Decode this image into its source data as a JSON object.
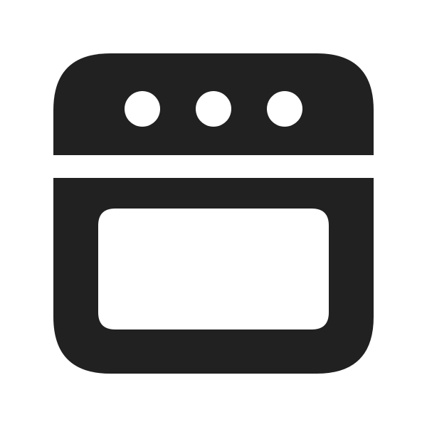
{
  "icon": {
    "name": "oven-icon",
    "color": "#212121",
    "background": "#ffffff",
    "knob_count": 3
  }
}
